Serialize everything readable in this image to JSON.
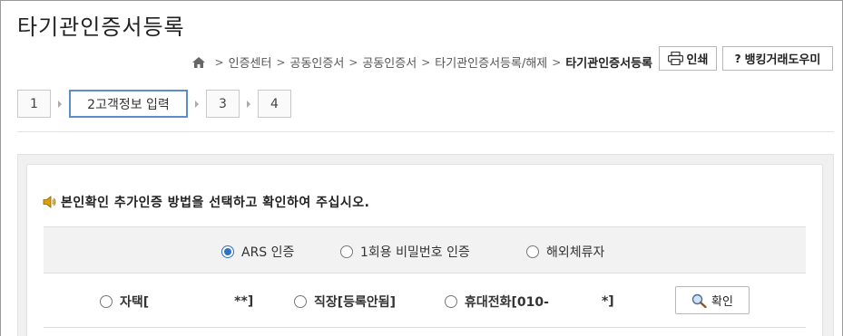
{
  "header": {
    "title": "타기관인증서등록"
  },
  "breadcrumb": {
    "items": [
      "인증센터",
      "공동인증서",
      "공동인증서",
      "타기관인증서등록/해제"
    ],
    "current": "타기관인증서등록",
    "separator": ">"
  },
  "utility": {
    "print_label": "인쇄",
    "help_label": "뱅킹거래도우미"
  },
  "steps": [
    {
      "label": "1",
      "active": false
    },
    {
      "label": "2고객정보 입력",
      "active": true
    },
    {
      "label": "3",
      "active": false
    },
    {
      "label": "4",
      "active": false
    }
  ],
  "notice": {
    "text": "본인확인 추가인증 방법을 선택하고 확인하여 주십시오."
  },
  "auth_methods": {
    "options": [
      {
        "label": "ARS 인증",
        "checked": true
      },
      {
        "label": "1회용 비밀번호 인증",
        "checked": false
      },
      {
        "label": "해외체류자",
        "checked": false
      }
    ]
  },
  "phones": {
    "options": [
      {
        "label_start": "자택[",
        "label_end": "**]",
        "checked": false
      },
      {
        "label_start": "직장[등록안됨]",
        "label_end": "",
        "checked": false
      },
      {
        "label_start": "휴대전화[010-",
        "label_end": "*]",
        "checked": false
      }
    ],
    "confirm_label": "확인"
  },
  "colors": {
    "accent": "#2f6fc4",
    "active_step_border": "#5b8ec9",
    "notice_icon": "#e0a000"
  }
}
